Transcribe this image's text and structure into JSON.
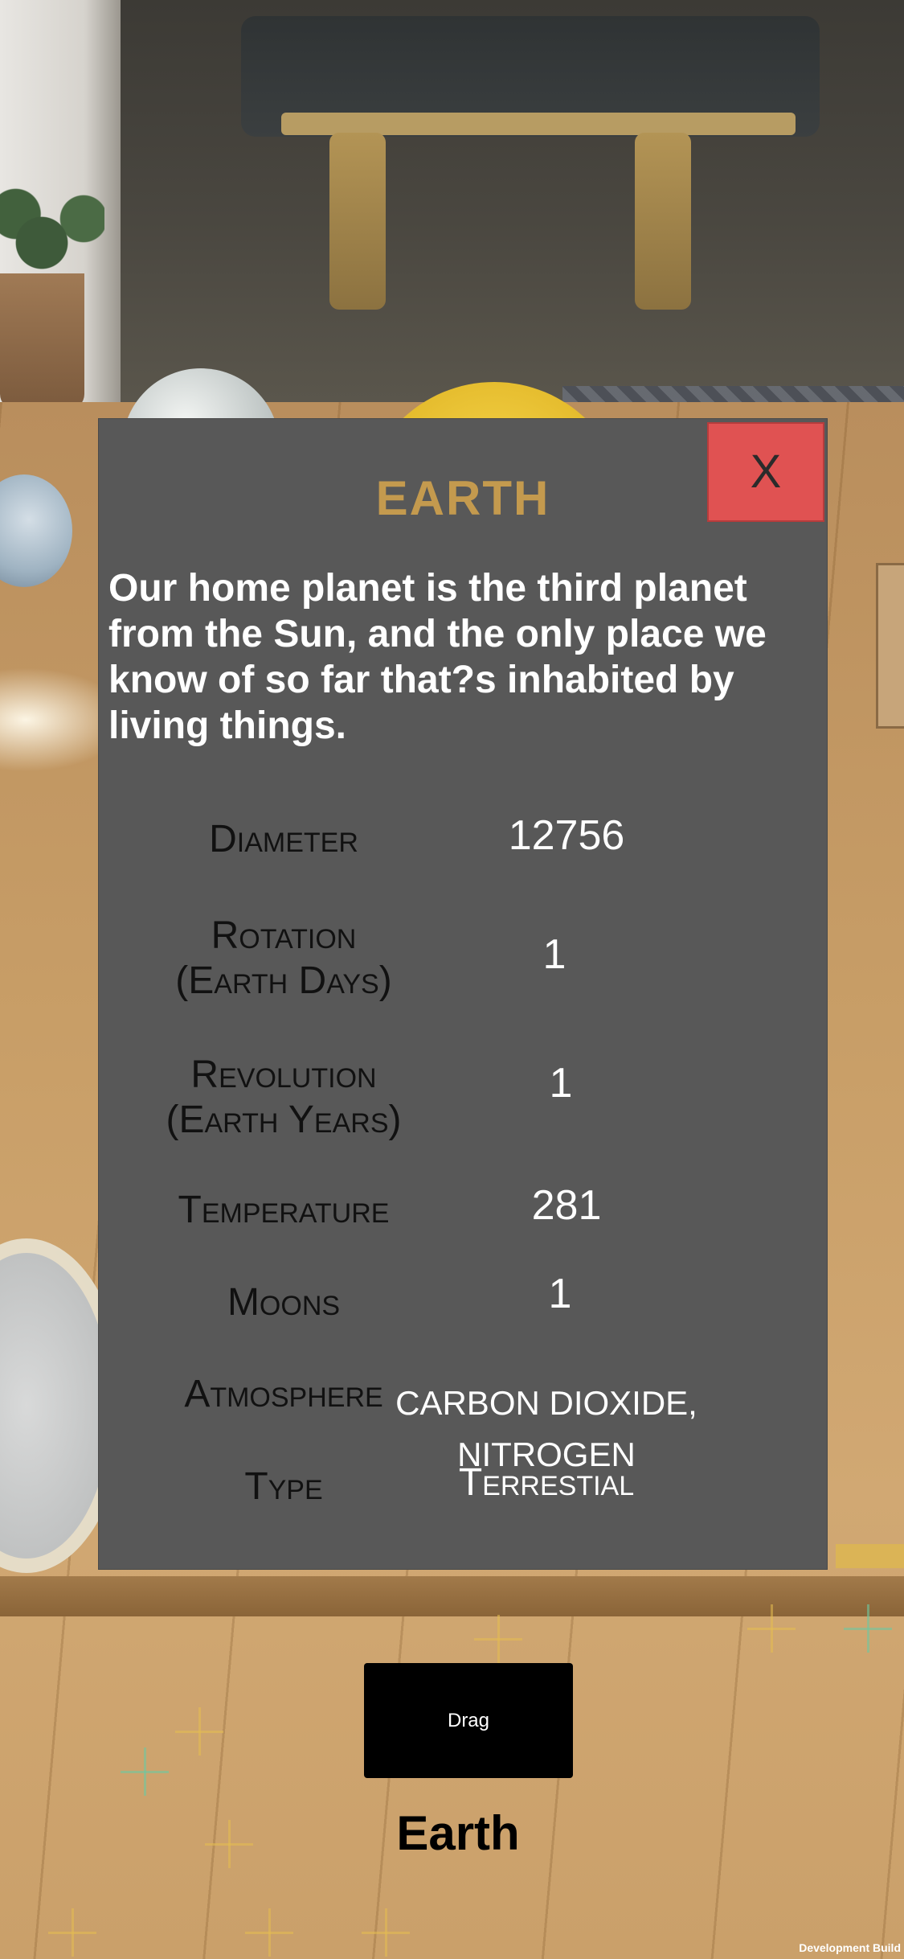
{
  "panel": {
    "close_label": "X",
    "title": "EARTH",
    "description": "Our home planet is the third planet from the Sun, and the only place we know of so far that?s inhabited by living things.",
    "stats": [
      {
        "label_lines": [
          "Diameter"
        ],
        "value": "12756"
      },
      {
        "label_lines": [
          "Rotation",
          "(Earth Days)"
        ],
        "value": "1"
      },
      {
        "label_lines": [
          "Revolution",
          "(Earth Years)"
        ],
        "value": "1"
      },
      {
        "label_lines": [
          "Temperature"
        ],
        "value": "281"
      },
      {
        "label_lines": [
          "Moons"
        ],
        "value": "1"
      },
      {
        "label_lines": [
          "Atmosphere"
        ],
        "value_lines": [
          "CARBON DIOXIDE,",
          "NITROGEN"
        ]
      },
      {
        "label_lines": [
          "Type"
        ],
        "value": "Terrestial"
      }
    ]
  },
  "controls": {
    "drag_label": "Drag",
    "planet_name": "Earth"
  },
  "footer": {
    "dev_build": "Development Build"
  },
  "colors": {
    "panel_bg": "#585858",
    "title": "#c49a4e",
    "close_bg": "#e05252"
  }
}
